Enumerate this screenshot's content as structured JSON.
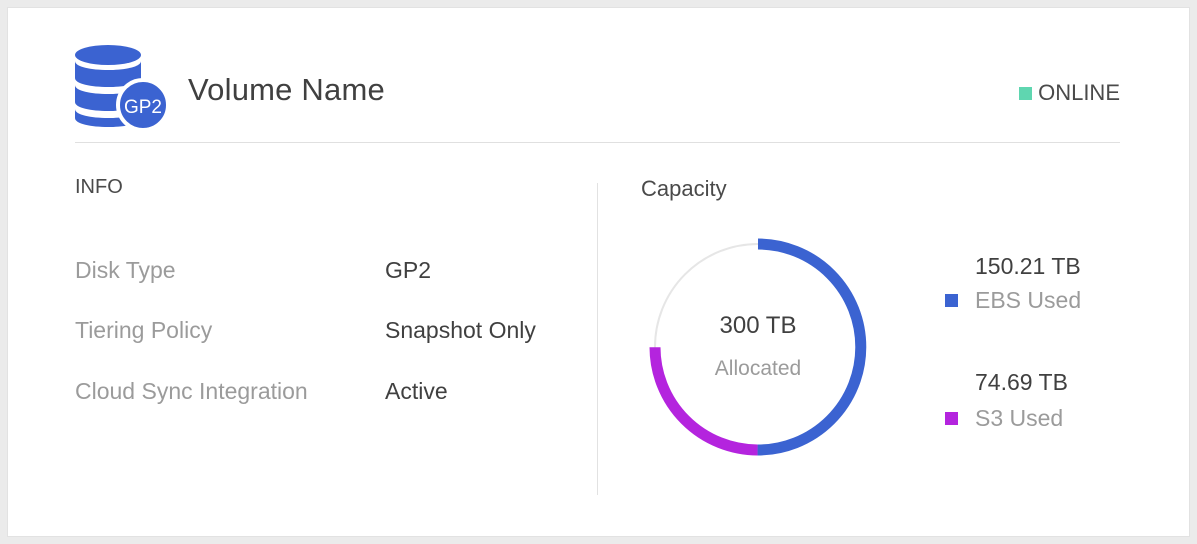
{
  "volume": {
    "name": "Volume Name",
    "type_badge": "GP2",
    "status": "ONLINE"
  },
  "colors": {
    "status_online": "#5fd6b0",
    "ebs": "#3b63d1",
    "s3": "#b424de",
    "icon": "#3b63d1"
  },
  "info": {
    "title": "INFO",
    "rows": [
      {
        "label": "Disk Type",
        "value": "GP2"
      },
      {
        "label": "Tiering Policy",
        "value": "Snapshot Only"
      },
      {
        "label": "Cloud Sync Integration",
        "value": "Active"
      }
    ]
  },
  "capacity": {
    "title": "Capacity",
    "allocated_value": "300 TB",
    "allocated_label": "Allocated",
    "allocated_tb": 300,
    "legend": [
      {
        "value": "150.21 TB",
        "label": "EBS Used",
        "tb": 150.21,
        "color": "#3b63d1"
      },
      {
        "value": "74.69 TB",
        "label": "S3 Used",
        "tb": 74.69,
        "color": "#b424de"
      }
    ]
  }
}
